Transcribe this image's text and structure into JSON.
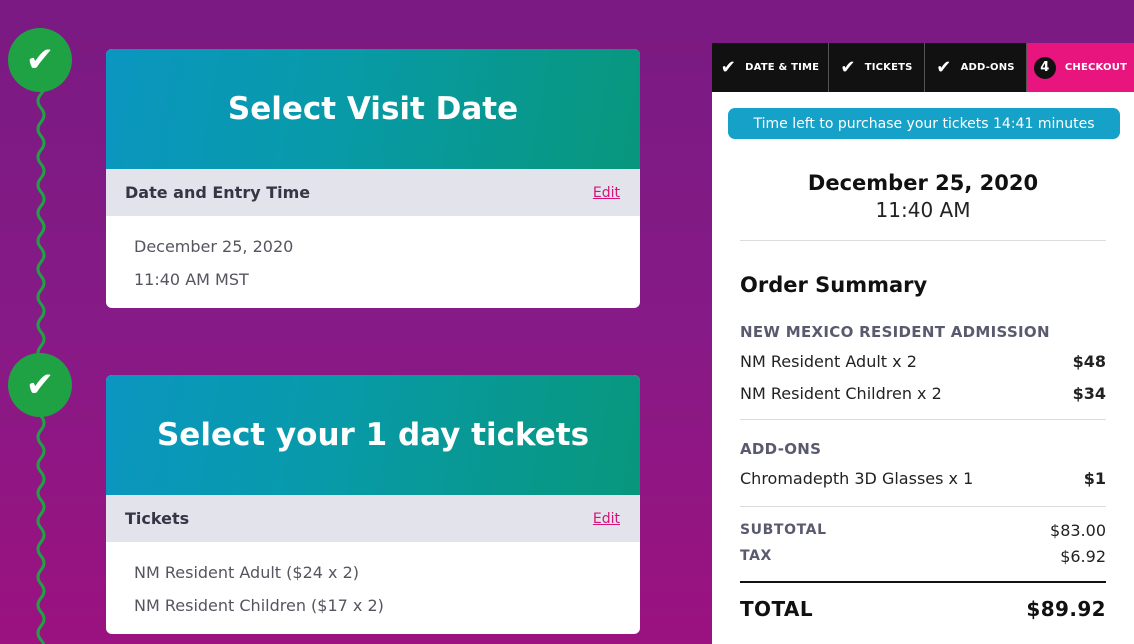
{
  "cards": [
    {
      "hero_title": "Select Visit Date",
      "bar_label": "Date and Entry Time",
      "edit_label": "Edit",
      "lines": [
        "December 25, 2020",
        "11:40 AM MST"
      ]
    },
    {
      "hero_title": "Select your 1 day tickets",
      "bar_label": "Tickets",
      "edit_label": "Edit",
      "lines": [
        "NM Resident Adult ($24 x 2)",
        "NM Resident Children ($17 x 2)"
      ]
    }
  ],
  "timeline": {
    "check_glyph": "✔"
  },
  "checkout": {
    "steps": [
      {
        "label": "DATE & TIME",
        "icon": "check-icon",
        "state": "done"
      },
      {
        "label": "TICKETS",
        "icon": "check-icon",
        "state": "done"
      },
      {
        "label": "ADD-ONS",
        "icon": "check-icon",
        "state": "done"
      },
      {
        "label": "CHECKOUT",
        "number": "4",
        "state": "active"
      }
    ],
    "timer_text": "Time left to purchase your tickets 14:41 minutes",
    "visit_date": "December 25, 2020",
    "visit_time": "11:40 AM",
    "summary_title": "Order Summary",
    "admission_heading": "NEW MEXICO RESIDENT ADMISSION",
    "admission_items": [
      {
        "name": "NM Resident Adult x 2",
        "price": "$48"
      },
      {
        "name": "NM Resident Children x 2",
        "price": "$34"
      }
    ],
    "addons_heading": "ADD-ONS",
    "addon_items": [
      {
        "name": "Chromadepth 3D Glasses x 1",
        "price": "$1"
      }
    ],
    "subtotal_label": "SUBTOTAL",
    "subtotal_value": "$83.00",
    "tax_label": "TAX",
    "tax_value": "$6.92",
    "total_label": "TOTAL",
    "total_value": "$89.92"
  },
  "colors": {
    "background": "#7a1a82",
    "accent_pink": "#e8157f",
    "timeline_green": "#1fa243",
    "timer_blue": "#16a1c9"
  }
}
